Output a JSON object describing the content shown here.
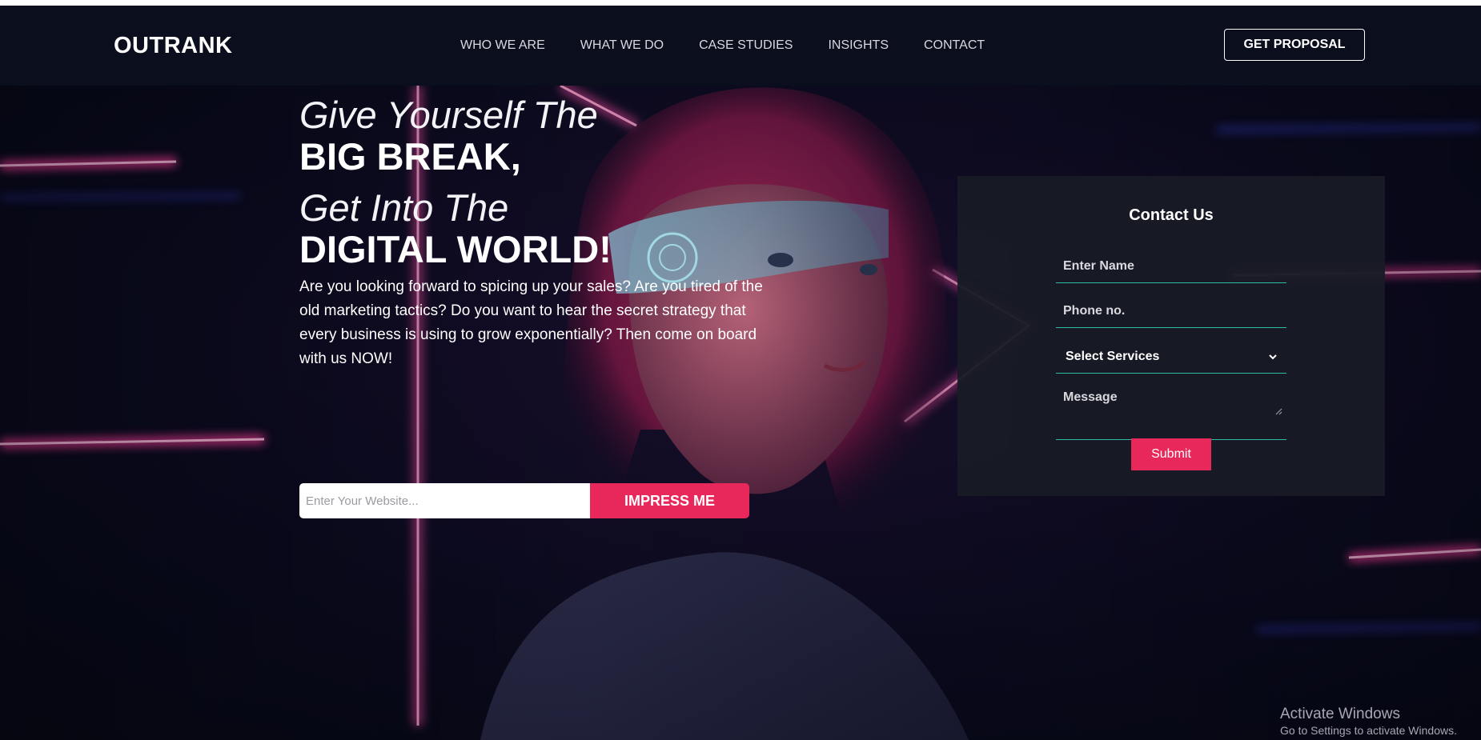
{
  "brand": {
    "logo": "OUTRANK"
  },
  "nav": {
    "links": [
      "WHO WE ARE",
      "WHAT WE DO",
      "CASE STUDIES",
      "INSIGHTS",
      "CONTACT"
    ],
    "cta": "GET PROPOSAL"
  },
  "hero": {
    "line1": "Give Yourself The",
    "line2": "BIG BREAK,",
    "line3": "Get Into The",
    "line4": "DIGITAL WORLD!",
    "intro": "Are you looking forward to spicing up your sales? Are you tired of the old marketing tactics? Do you want to hear the secret strategy that every business is using to grow exponentially? Then come on board with us NOW!",
    "website_placeholder": "Enter Your Website...",
    "cta_button": "IMPRESS ME"
  },
  "contact": {
    "title": "Contact Us",
    "name_placeholder": "Enter Name",
    "phone_placeholder": "Phone no.",
    "services_selected": "Select Services",
    "message_placeholder": "Message",
    "submit": "Submit"
  },
  "watermark": {
    "title": "Activate Windows",
    "subtitle": "Go to Settings to activate Windows."
  },
  "colors": {
    "accent": "#e8285a",
    "field_underline": "#2fb9a6",
    "header_bg": "#0b0e1c",
    "card_bg": "#181b26"
  },
  "icons": {
    "select_chevron": "chevron-down-icon",
    "textarea_resize": "resize-grip-icon"
  }
}
